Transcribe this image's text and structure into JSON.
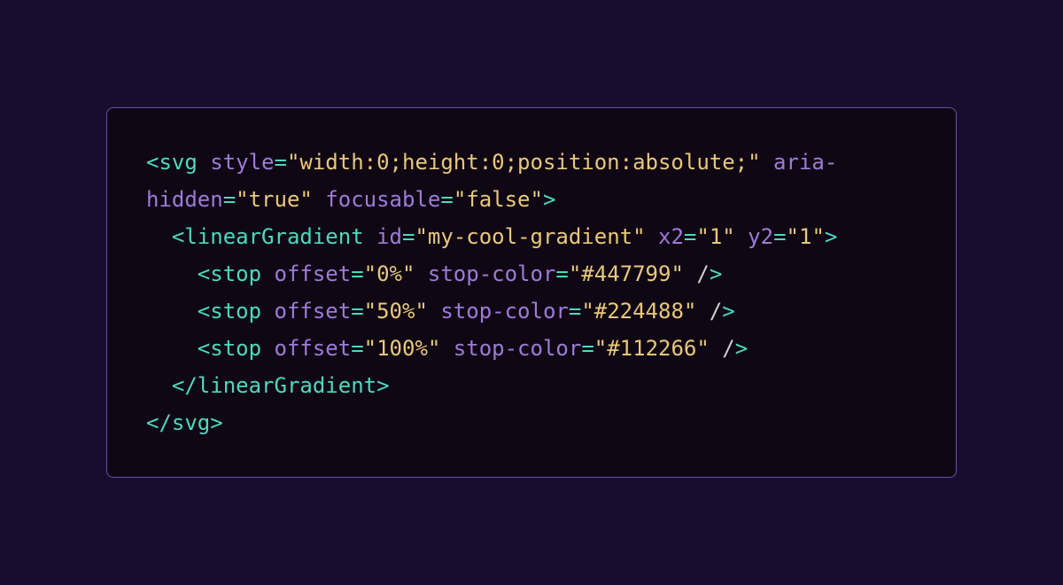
{
  "code": {
    "line1": {
      "t1": "<svg",
      "a1": " style",
      "p1": "=",
      "v1": "\"width:0;height:0;position:absolute;\"",
      "a2": " aria-hidden",
      "p2": "=",
      "v2": "\"true\"",
      "a3": " focusable",
      "p3": "=",
      "v3": "\"false\"",
      "t2": ">"
    },
    "line2": {
      "indent": "  ",
      "t1": "<linearGradient",
      "a1": " id",
      "p1": "=",
      "v1": "\"my-cool-gradient\"",
      "a2": " x2",
      "p2": "=",
      "v2": "\"1\"",
      "a3": " y2",
      "p3": "=",
      "v3": "\"1\"",
      "t2": ">"
    },
    "line3": {
      "indent": "    ",
      "t1": "<stop",
      "a1": " offset",
      "p1": "=",
      "v1": "\"0%\"",
      "a2": " stop-color",
      "p2": "=",
      "v2": "\"#447799\"",
      "s": " /",
      "t2": ">"
    },
    "line4": {
      "indent": "    ",
      "t1": "<stop",
      "a1": " offset",
      "p1": "=",
      "v1": "\"50%\"",
      "a2": " stop-color",
      "p2": "=",
      "v2": "\"#224488\"",
      "s": " /",
      "t2": ">"
    },
    "line5": {
      "indent": "    ",
      "t1": "<stop",
      "a1": " offset",
      "p1": "=",
      "v1": "\"100%\"",
      "a2": " stop-color",
      "p2": "=",
      "v2": "\"#112266\"",
      "s": " /",
      "t2": ">"
    },
    "line6": {
      "indent": "  ",
      "t1": "</linearGradient>"
    },
    "line7": {
      "t1": "</svg>"
    }
  }
}
